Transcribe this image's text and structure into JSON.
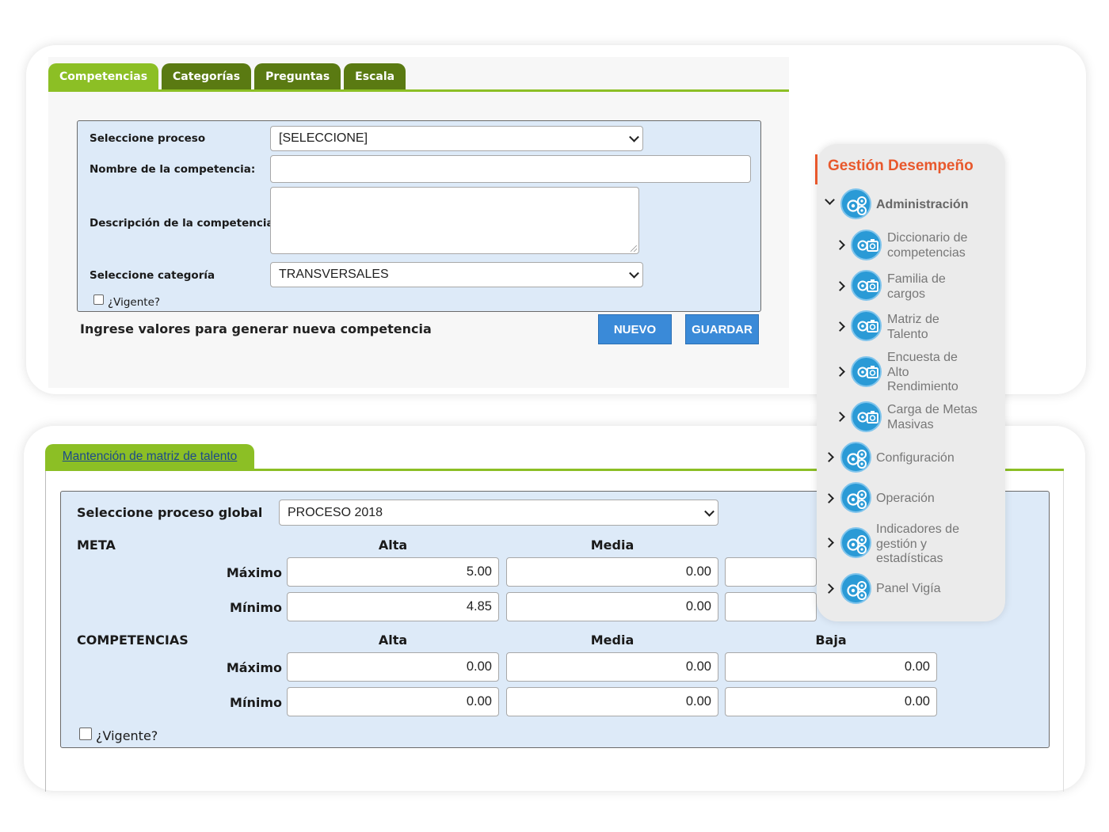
{
  "competencias_form": {
    "tabs": [
      "Competencias",
      "Categorías",
      "Preguntas",
      "Escala"
    ],
    "active_tab": "Competencias",
    "proceso_label": "Seleccione proceso",
    "proceso_value": "[SELECCIONE]",
    "nombre_label": "Nombre de la competencia:",
    "nombre_value": "",
    "descripcion_label": "Descripción de la competencia:",
    "descripcion_value": "",
    "categoria_label": "Seleccione categoría",
    "categoria_value": "TRANSVERSALES",
    "vigente_label": "¿Vigente?",
    "vigente_checked": false,
    "message": "Ingrese valores para generar nueva competencia",
    "nuevo_label": "NUEVO",
    "guardar_label": "GUARDAR"
  },
  "matriz_form": {
    "tab_label": "Mantención de matriz de talento",
    "proceso_label": "Seleccione proceso global",
    "proceso_value": "PROCESO 2018",
    "meta": {
      "title": "META",
      "columns": [
        "Alta",
        "Media"
      ],
      "maximo_label": "Máximo",
      "minimo_label": "Mínimo",
      "maximo": [
        "5.00",
        "0.00"
      ],
      "minimo": [
        "4.85",
        "0.00"
      ]
    },
    "competencias": {
      "title": "COMPETENCIAS",
      "columns": [
        "Alta",
        "Media",
        "Baja"
      ],
      "maximo_label": "Máximo",
      "minimo_label": "Mínimo",
      "maximo": [
        "0.00",
        "0.00",
        "0.00"
      ],
      "minimo": [
        "0.00",
        "0.00",
        "0.00"
      ]
    },
    "vigente_label": "¿Vigente?",
    "vigente_checked": false
  },
  "side_menu": {
    "title": "Gestión Desempeño",
    "items": [
      {
        "label": "Administración",
        "expanded": true,
        "icon": "gears-icon"
      },
      {
        "label": "Diccionario de competencias",
        "icon": "camera-gear-icon"
      },
      {
        "label": "Familia de cargos",
        "icon": "camera-gear-icon"
      },
      {
        "label": "Matriz de Talento",
        "icon": "camera-gear-icon"
      },
      {
        "label": "Encuesta de Alto Rendimiento",
        "icon": "camera-gear-icon"
      },
      {
        "label": "Carga de Metas Masivas",
        "icon": "camera-gear-icon"
      },
      {
        "label": "Configuración",
        "icon": "gears-icon"
      },
      {
        "label": "Operación",
        "icon": "gears-icon"
      },
      {
        "label": "Indicadores de gestión y estadísticas",
        "icon": "gears-icon"
      },
      {
        "label": "Panel Vigía",
        "icon": "gears-icon"
      }
    ]
  },
  "colors": {
    "tab_active": "#8cbf25",
    "tab_inactive": "#5a7a12",
    "form_bg": "#ddeaf8",
    "button_blue": "#3a8ad8",
    "menu_title": "#e8582c",
    "menu_icon": "#2a9ad6"
  }
}
